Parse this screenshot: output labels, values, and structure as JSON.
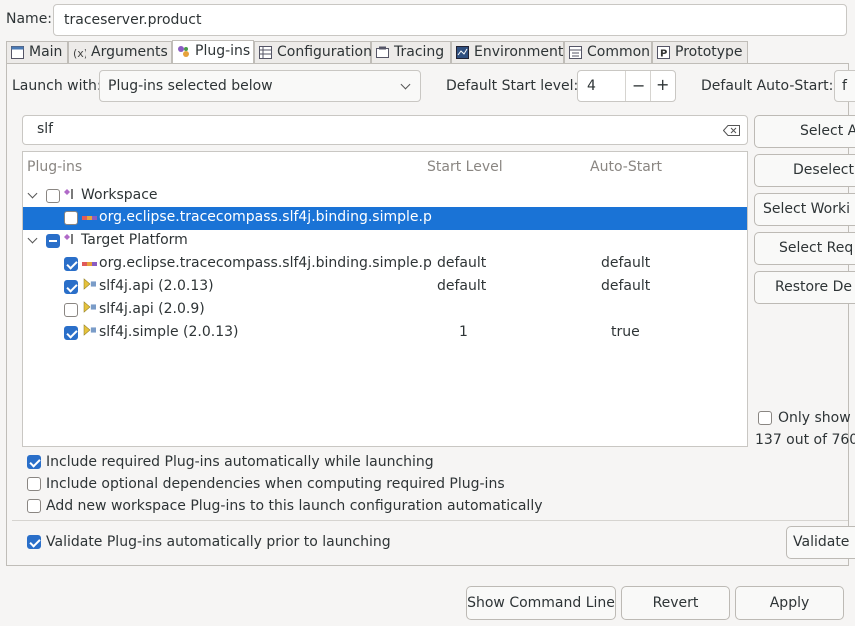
{
  "name_label": "Name:",
  "name_value": "traceserver.product",
  "tabs": [
    {
      "label": "Main",
      "underline": "M",
      "rest": "ain"
    },
    {
      "label": "Arguments",
      "underline": "",
      "rest": "Arguments"
    },
    {
      "label": "Plug-ins",
      "underline": "",
      "rest": "Plug-ins"
    },
    {
      "label": "Configuration",
      "underline": "",
      "rest": "Configuration"
    },
    {
      "label": "Tracing",
      "underline": "",
      "rest": "Tracing"
    },
    {
      "label": "Environment",
      "underline": "",
      "rest": "Environment"
    },
    {
      "label": "Common",
      "underline": "",
      "rest": "Common"
    },
    {
      "label": "Prototype",
      "underline": "",
      "rest": "Prototype"
    }
  ],
  "launch_with_label": "Launch with:",
  "launch_with_value": "Plug-ins selected below",
  "default_start_level_label": "Default Start level:",
  "default_start_level_value": "4",
  "default_auto_start_label": "Default Auto-Start:",
  "default_auto_start_value": "f",
  "filter_value": "slf",
  "columns": {
    "plugins": "Plug-ins",
    "start_level": "Start Level",
    "auto_start": "Auto-Start"
  },
  "tree": {
    "workspace": {
      "label": "Workspace",
      "checked": false
    },
    "workspace_items": [
      {
        "name": "org.eclipse.tracecompass.slf4j.binding.simple.p",
        "start": "",
        "auto": "",
        "checked": false,
        "selected": true
      }
    ],
    "target": {
      "label": "Target Platform",
      "state": "partial"
    },
    "target_items": [
      {
        "name": "org.eclipse.tracecompass.slf4j.binding.simple.p",
        "start": "default",
        "auto": "default",
        "checked": true
      },
      {
        "name": "slf4j.api (2.0.13)",
        "start": "default",
        "auto": "default",
        "checked": true
      },
      {
        "name": "slf4j.api (2.0.9)",
        "start": "",
        "auto": "",
        "checked": false
      },
      {
        "name": "slf4j.simple (2.0.13)",
        "start": "1",
        "auto": "true",
        "checked": true
      }
    ]
  },
  "side_buttons": [
    "Select A",
    "Deselect",
    "Select Worki",
    "Select Req",
    "Restore De"
  ],
  "only_show_label": "Only show",
  "count_text": "137 out of 760",
  "options": [
    {
      "label": "Include required Plug-ins automatically while launching",
      "checked": true
    },
    {
      "label": "Include optional dependencies when computing required Plug-ins",
      "checked": false
    },
    {
      "label": "Add new workspace Plug-ins to this launch configuration automatically",
      "checked": false
    }
  ],
  "validate_option": {
    "label": "Validate Plug-ins automatically prior to launching",
    "checked": true
  },
  "validate_button": "Validate",
  "bottom_buttons": {
    "show_command_line": "Show Command Line",
    "revert": "Revert",
    "apply": "Apply"
  },
  "colors": {
    "selection": "#1a73d6",
    "checkbox": "#2a6fc9"
  }
}
